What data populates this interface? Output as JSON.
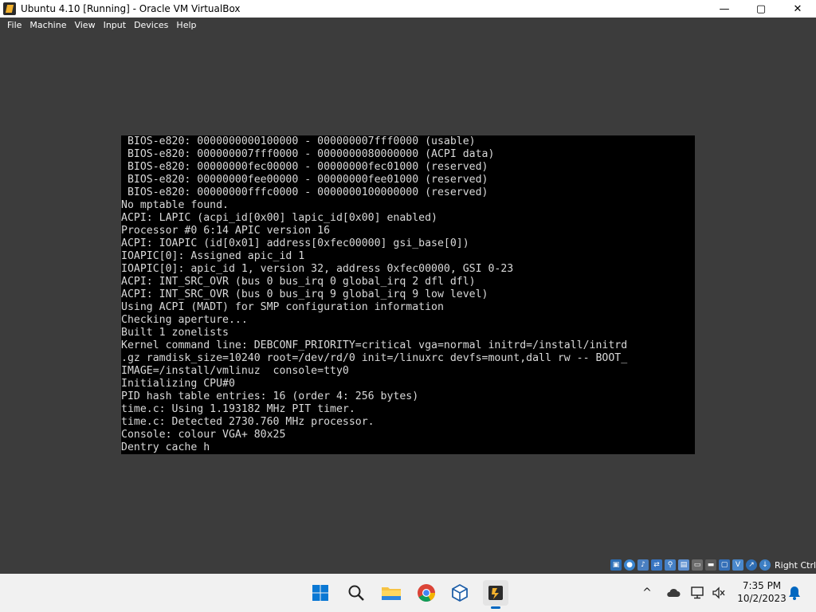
{
  "window": {
    "title": "Ubuntu 4.10 [Running] - Oracle VM VirtualBox",
    "controls": {
      "minimize": "—",
      "maximize": "▢",
      "close": "✕"
    }
  },
  "menubar": {
    "items": [
      "File",
      "Machine",
      "View",
      "Input",
      "Devices",
      "Help"
    ]
  },
  "console": {
    "lines": [
      " BIOS-e820: 0000000000100000 - 000000007fff0000 (usable)",
      " BIOS-e820: 000000007fff0000 - 0000000080000000 (ACPI data)",
      " BIOS-e820: 00000000fec00000 - 00000000fec01000 (reserved)",
      " BIOS-e820: 00000000fee00000 - 00000000fee01000 (reserved)",
      " BIOS-e820: 00000000fffc0000 - 0000000100000000 (reserved)",
      "No mptable found.",
      "ACPI: LAPIC (acpi_id[0x00] lapic_id[0x00] enabled)",
      "Processor #0 6:14 APIC version 16",
      "ACPI: IOAPIC (id[0x01] address[0xfec00000] gsi_base[0])",
      "IOAPIC[0]: Assigned apic_id 1",
      "IOAPIC[0]: apic_id 1, version 32, address 0xfec00000, GSI 0-23",
      "ACPI: INT_SRC_OVR (bus 0 bus_irq 0 global_irq 2 dfl dfl)",
      "ACPI: INT_SRC_OVR (bus 0 bus_irq 9 global_irq 9 low level)",
      "Using ACPI (MADT) for SMP configuration information",
      "Checking aperture...",
      "Built 1 zonelists",
      "Kernel command line: DEBCONF_PRIORITY=critical vga=normal initrd=/install/initrd",
      ".gz ramdisk_size=10240 root=/dev/rd/0 init=/linuxrc devfs=mount,dall rw -- BOOT_",
      "IMAGE=/install/vmlinuz  console=tty0",
      "Initializing CPU#0",
      "PID hash table entries: 16 (order 4: 256 bytes)",
      "time.c: Using 1.193182 MHz PIT timer.",
      "time.c: Detected 2730.760 MHz processor.",
      "Console: colour VGA+ 80x25",
      "Dentry cache h"
    ]
  },
  "statusbar": {
    "icons": [
      "hard-disk-icon",
      "optical-drive-icon",
      "audio-icon",
      "network-icon",
      "usb-icon",
      "shared-folders-icon",
      "display-icon",
      "video-capture-icon",
      "recording-icon",
      "cpu-icon",
      "mouse-integration-icon",
      "keyboard-icon"
    ],
    "host_key": "Right Ctrl"
  },
  "taskbar": {
    "apps": [
      "start-icon",
      "search-icon",
      "file-explorer-icon",
      "chrome-icon",
      "virtualbox-manager-icon",
      "virtualbox-vm-icon"
    ],
    "tray": {
      "overflow": "^",
      "time": "7:35 PM",
      "date": "10/2/2023"
    }
  },
  "colors": {
    "vm_background": "#3c3c3c",
    "console_text": "#d9d9d9",
    "console_background": "#000000",
    "taskbar": "#f1f1f1",
    "accent": "#0067c0"
  }
}
